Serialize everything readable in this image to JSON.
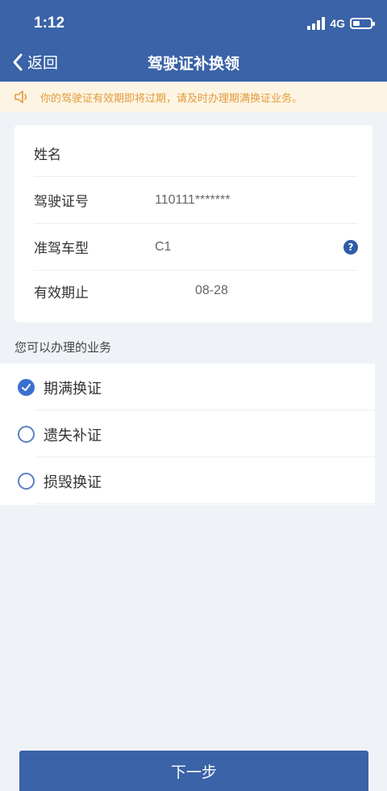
{
  "status_bar": {
    "time": "1:12",
    "network": "4G"
  },
  "nav": {
    "back_label": "返回",
    "title": "驾驶证补换领"
  },
  "notice": {
    "text": "你的驾驶证有效期即将过期，请及时办理期满换证业务。"
  },
  "license_info": [
    {
      "label": "姓名",
      "value": ""
    },
    {
      "label": "驾驶证号",
      "value": "110111*******"
    },
    {
      "label": "准驾车型",
      "value": "C1"
    },
    {
      "label": "有效期止",
      "value": "08-28"
    }
  ],
  "help_glyph": "?",
  "services": {
    "title": "您可以办理的业务",
    "options": [
      {
        "label": "期满换证",
        "selected": true
      },
      {
        "label": "遗失补证",
        "selected": false
      },
      {
        "label": "损毁换证",
        "selected": false
      }
    ]
  },
  "next_button": "下一步",
  "colors": {
    "primary": "#3a63a8",
    "notice_bg": "#fdf5e3",
    "notice_text": "#e39a3b",
    "page_bg": "#eff3f7"
  },
  "icons": {
    "back": "chevron-left-icon",
    "notice": "speaker-icon",
    "help": "question-icon",
    "check": "check-icon"
  }
}
